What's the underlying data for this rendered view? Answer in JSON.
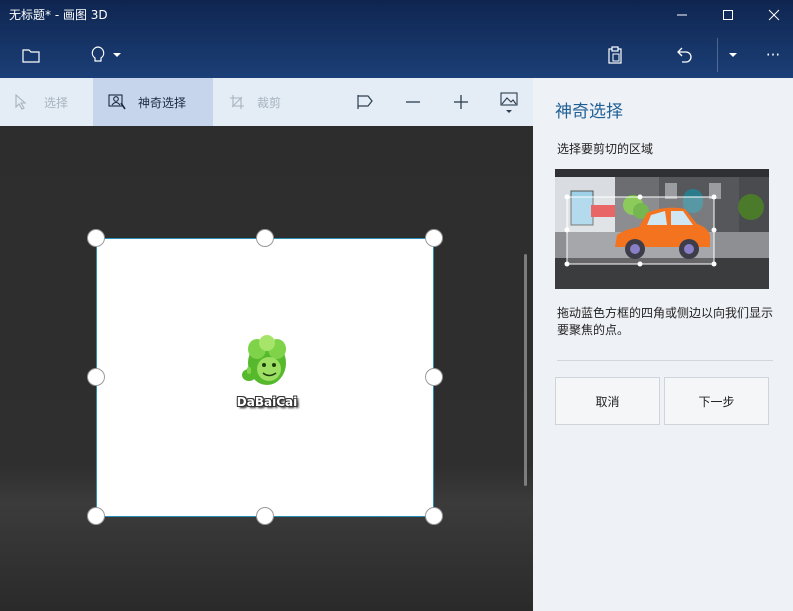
{
  "window": {
    "title": "无标题* - 画图 3D",
    "minimize_glyph": "—",
    "maximize_glyph": "☐",
    "close_glyph": "✕"
  },
  "appbar": {
    "more_glyph": "···",
    "icons": [
      "folder-icon",
      "lightbulb-icon",
      "paste-icon",
      "undo-icon",
      "history-dropdown-icon",
      "more-icon"
    ]
  },
  "toolbar": {
    "select_label": "选择",
    "magic_select_label": "神奇选择",
    "crop_label": "裁剪",
    "icons": [
      "cursor-icon",
      "magic-select-icon",
      "crop-icon",
      "flag-icon",
      "minus-icon",
      "plus-icon",
      "image-icon"
    ]
  },
  "canvas": {
    "logo_text": "DaBaiCai"
  },
  "panel": {
    "title": "神奇选择",
    "subtitle": "选择要剪切的区域",
    "description": "拖动蓝色方框的四角或侧边以向我们显示要聚焦的点。",
    "cancel_label": "取消",
    "next_label": "下一步"
  },
  "colors": {
    "titlebar": "#0f2550",
    "toolbar_bg": "#e4edf6",
    "active_tool": "#c6d5ec",
    "panel_title": "#1f5f96",
    "canvas_bg": "#2d2d2d",
    "selection_border": "#2a8fb3",
    "car": "#f4731f"
  }
}
